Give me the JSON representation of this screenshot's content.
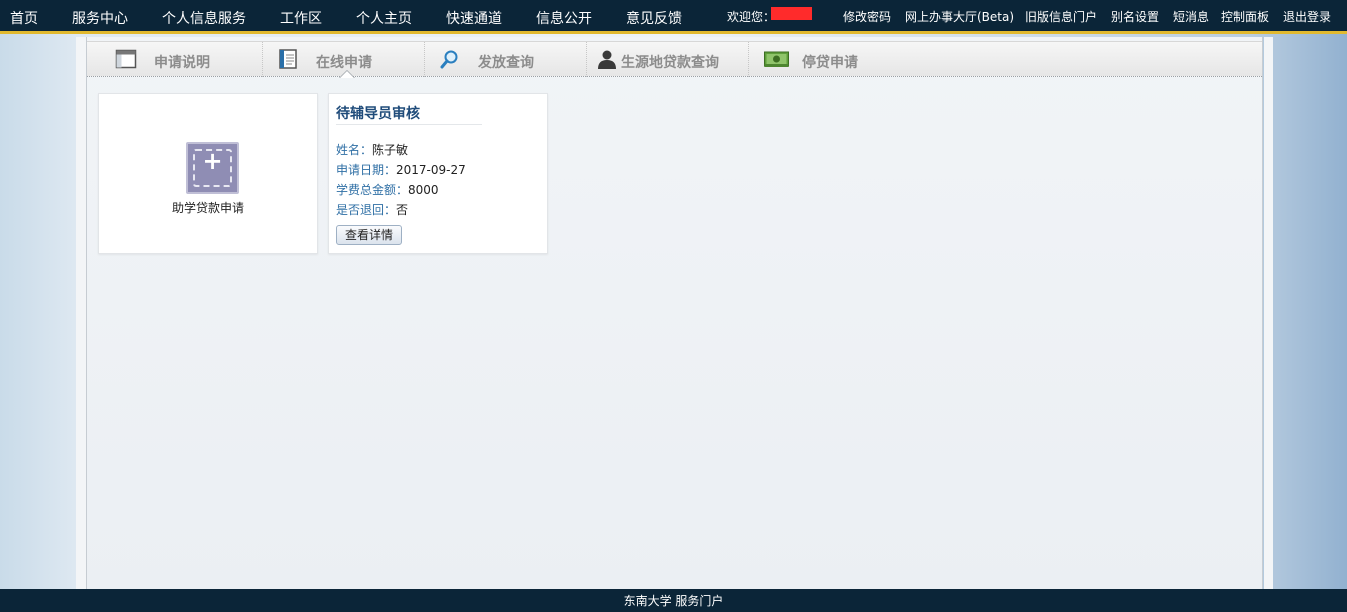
{
  "nav": {
    "items": [
      "首页",
      "服务中心",
      "个人信息服务",
      "工作区",
      "个人主页",
      "快速通道",
      "信息公开",
      "意见反馈"
    ],
    "welcome": "欢迎您：",
    "right_links": [
      "修改密码",
      "网上办事大厅(Beta)",
      "旧版信息门户",
      "别名设置",
      "短消息",
      "控制面板",
      "退出登录"
    ]
  },
  "tabs": [
    {
      "label": "申请说明",
      "icon": "window-icon"
    },
    {
      "label": "在线申请",
      "icon": "document-icon",
      "active": true
    },
    {
      "label": "发放查询",
      "icon": "magnifier-icon"
    },
    {
      "label": "生源地贷款查询",
      "icon": "person-icon"
    },
    {
      "label": "停贷申请",
      "icon": "money-icon"
    }
  ],
  "apply_card": {
    "label": "助学贷款申请",
    "icon": "add-icon"
  },
  "status_card": {
    "title": "待辅导员审核",
    "name_key": "姓名：",
    "name_val": "陈子敏",
    "date_key": "申请日期：",
    "date_val": "2017-09-27",
    "amount_key": "学费总金额：",
    "amount_val": "8000",
    "returned_key": "是否退回：",
    "returned_val": "否",
    "button": "查看详情"
  },
  "footer": "东南大学  服务门户",
  "colors": {
    "topbar": "#0b2538",
    "accent": "#e1b92f",
    "title": "#1f4b7a",
    "key": "#2f6fa5"
  }
}
